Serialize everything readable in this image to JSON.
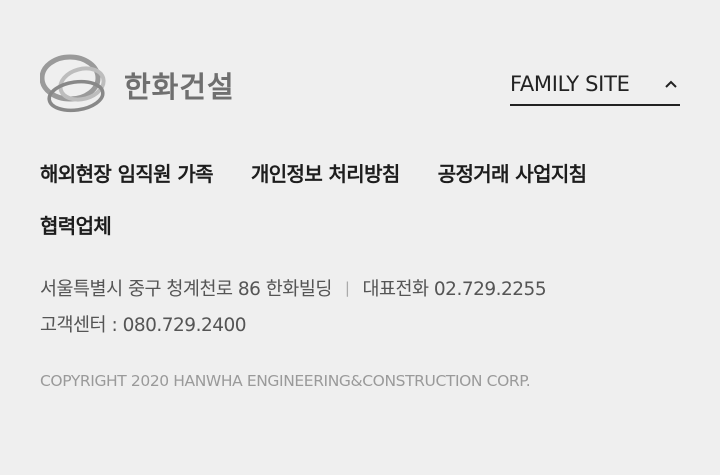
{
  "header": {
    "logo_text": "한화건설",
    "logo_icon": "hanwha-rings-logo",
    "family_site": {
      "label": "FAMILY SITE",
      "icon": "chevron-up-icon"
    }
  },
  "nav": {
    "row1": [
      "해외현장 임직원 가족",
      "개인정보 처리방침",
      "공정거래 사업지침"
    ],
    "row2": [
      "협력업체"
    ]
  },
  "info": {
    "address": "서울특별시 중구 청계천로 86 한화빌딩",
    "separator": "|",
    "phone": "대표전화 02.729.2255",
    "customer_center": "고객센터 : 080.729.2400"
  },
  "copyright": "COPYRIGHT 2020 HANWHA ENGINEERING&CONSTRUCTION CORP.",
  "colors": {
    "background": "#efefef",
    "logo": "#8a8a8a",
    "text_dark": "#1d1d1d",
    "text_muted": "#9a9a9a"
  }
}
